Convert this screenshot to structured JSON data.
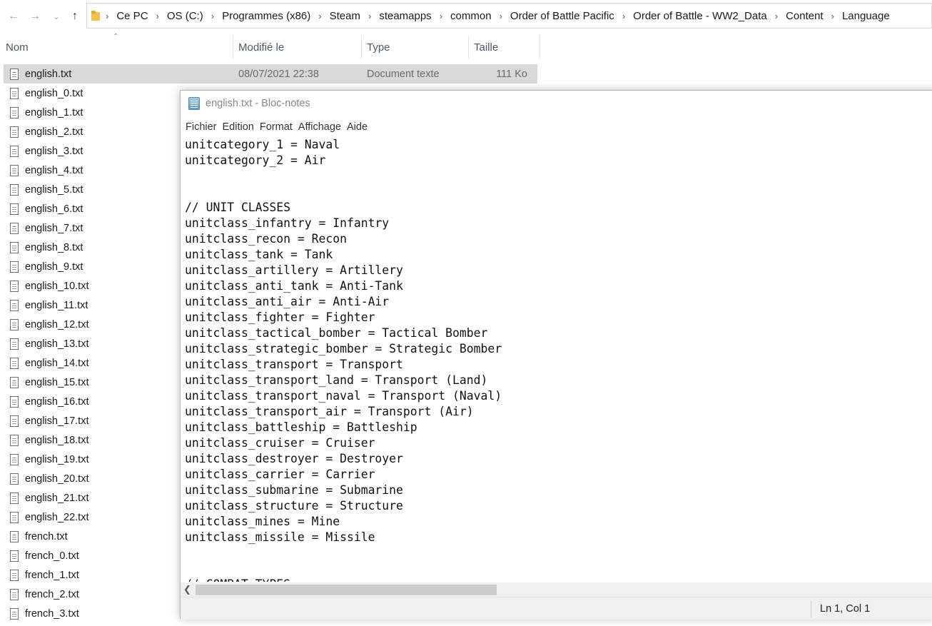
{
  "explorer": {
    "breadcrumb": [
      "Ce PC",
      "OS (C:)",
      "Programmes (x86)",
      "Steam",
      "steamapps",
      "common",
      "Order of Battle  Pacific",
      "Order of Battle - WW2_Data",
      "Content",
      "Language"
    ],
    "columns": {
      "name": "Nom",
      "modified": "Modifié le",
      "type": "Type",
      "size": "Taille"
    },
    "files": [
      {
        "name": "english.txt",
        "date": "08/07/2021 22:38",
        "type": "Document texte",
        "size": "111 Ko"
      },
      {
        "name": "english_0.txt",
        "date": "",
        "type": "",
        "size": ""
      },
      {
        "name": "english_1.txt",
        "date": "",
        "type": "",
        "size": ""
      },
      {
        "name": "english_2.txt",
        "date": "",
        "type": "",
        "size": ""
      },
      {
        "name": "english_3.txt",
        "date": "",
        "type": "",
        "size": ""
      },
      {
        "name": "english_4.txt",
        "date": "",
        "type": "",
        "size": ""
      },
      {
        "name": "english_5.txt",
        "date": "",
        "type": "",
        "size": ""
      },
      {
        "name": "english_6.txt",
        "date": "",
        "type": "",
        "size": ""
      },
      {
        "name": "english_7.txt",
        "date": "",
        "type": "",
        "size": ""
      },
      {
        "name": "english_8.txt",
        "date": "",
        "type": "",
        "size": ""
      },
      {
        "name": "english_9.txt",
        "date": "",
        "type": "",
        "size": ""
      },
      {
        "name": "english_10.txt",
        "date": "",
        "type": "",
        "size": ""
      },
      {
        "name": "english_11.txt",
        "date": "",
        "type": "",
        "size": ""
      },
      {
        "name": "english_12.txt",
        "date": "",
        "type": "",
        "size": ""
      },
      {
        "name": "english_13.txt",
        "date": "",
        "type": "",
        "size": ""
      },
      {
        "name": "english_14.txt",
        "date": "",
        "type": "",
        "size": ""
      },
      {
        "name": "english_15.txt",
        "date": "",
        "type": "",
        "size": ""
      },
      {
        "name": "english_16.txt",
        "date": "",
        "type": "",
        "size": ""
      },
      {
        "name": "english_17.txt",
        "date": "",
        "type": "",
        "size": ""
      },
      {
        "name": "english_18.txt",
        "date": "",
        "type": "",
        "size": ""
      },
      {
        "name": "english_19.txt",
        "date": "",
        "type": "",
        "size": ""
      },
      {
        "name": "english_20.txt",
        "date": "",
        "type": "",
        "size": ""
      },
      {
        "name": "english_21.txt",
        "date": "",
        "type": "",
        "size": ""
      },
      {
        "name": "english_22.txt",
        "date": "",
        "type": "",
        "size": ""
      },
      {
        "name": "french.txt",
        "date": "",
        "type": "",
        "size": ""
      },
      {
        "name": "french_0.txt",
        "date": "",
        "type": "",
        "size": ""
      },
      {
        "name": "french_1.txt",
        "date": "",
        "type": "",
        "size": ""
      },
      {
        "name": "french_2.txt",
        "date": "",
        "type": "",
        "size": ""
      },
      {
        "name": "french_3.txt",
        "date": "",
        "type": "",
        "size": ""
      }
    ],
    "selected_index": 0
  },
  "notepad": {
    "title": "english.txt - Bloc-notes",
    "menu": [
      "Fichier",
      "Edition",
      "Format",
      "Affichage",
      "Aide"
    ],
    "lines": [
      "unitcategory_1 = Naval",
      "unitcategory_2 = Air",
      "",
      "",
      "// UNIT CLASSES",
      "unitclass_infantry = Infantry",
      "unitclass_recon = Recon",
      "unitclass_tank = Tank",
      "unitclass_artillery = Artillery",
      "unitclass_anti_tank = Anti-Tank",
      "unitclass_anti_air = Anti-Air",
      "unitclass_fighter = Fighter",
      "unitclass_tactical_bomber = Tactical Bomber",
      "unitclass_strategic_bomber = Strategic Bomber",
      "unitclass_transport = Transport",
      "unitclass_transport_land = Transport (Land)",
      "unitclass_transport_naval = Transport (Naval)",
      "unitclass_transport_air = Transport (Air)",
      "unitclass_battleship = Battleship",
      "unitclass_cruiser = Cruiser",
      "unitclass_destroyer = Destroyer",
      "unitclass_carrier = Carrier",
      "unitclass_submarine = Submarine",
      "unitclass_structure = Structure",
      "unitclass_mines = Mine",
      "unitclass_missile = Missile",
      "",
      "",
      "// COMBAT TYPES"
    ],
    "status_position": "Ln 1, Col 1"
  }
}
